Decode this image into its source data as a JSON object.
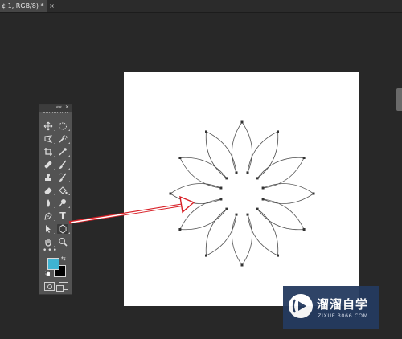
{
  "document": {
    "tab_title": "¢ 1, RGB/8) *",
    "tab_close": "×"
  },
  "tools_panel": {
    "collapse_glyph": "««",
    "close_glyph": "✕",
    "more_tools": "•••",
    "type_tool_glyph": "T",
    "tools": [
      "move-icon",
      "marquee-icon",
      "lasso-icon",
      "quick-select-icon",
      "crop-icon",
      "eyedropper-icon",
      "healing-brush-icon",
      "brush-icon",
      "clone-stamp-icon",
      "history-brush-icon",
      "eraser-icon",
      "paint-bucket-icon",
      "blur-icon",
      "dodge-icon",
      "pen-icon",
      "type-icon",
      "path-selection-icon",
      "custom-shape-icon",
      "hand-icon",
      "zoom-icon"
    ],
    "active_tool": "custom-shape-icon",
    "foreground_color": "#3fb3d2",
    "background_color": "#000000"
  },
  "watermark": {
    "title": "溜溜自学",
    "url": "ZIXUE.3066.COM",
    "bg_color": "#243a5f"
  }
}
